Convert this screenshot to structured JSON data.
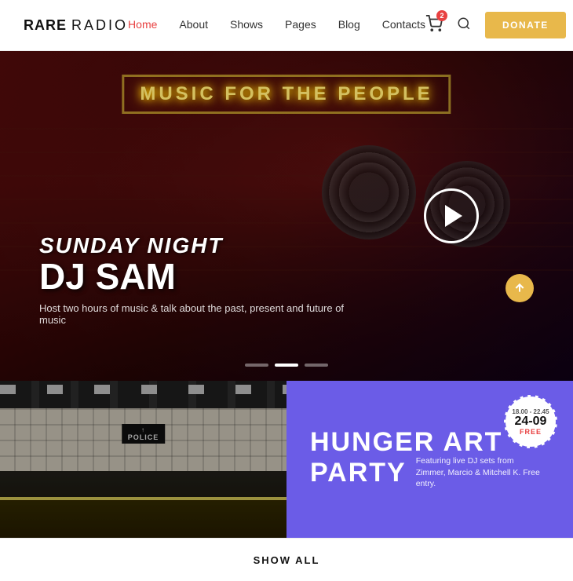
{
  "navbar": {
    "logo": {
      "part1": "RARE",
      "part2": "RADIO"
    },
    "links": [
      {
        "id": "home",
        "label": "Home",
        "active": true
      },
      {
        "id": "about",
        "label": "About",
        "active": false
      },
      {
        "id": "shows",
        "label": "Shows",
        "active": false
      },
      {
        "id": "pages",
        "label": "Pages",
        "active": false
      },
      {
        "id": "blog",
        "label": "Blog",
        "active": false
      },
      {
        "id": "contacts",
        "label": "Contacts",
        "active": false
      }
    ],
    "cart_badge": "2",
    "donate_label": "DONATE"
  },
  "hero": {
    "neon_text": "MUSIC FOR THE PEOPLE",
    "subtitle": "Sunday Night",
    "title": "DJ SAM",
    "description": "Host two hours of music & talk about the past, present and future of music"
  },
  "event": {
    "title_line1": "HUNGER ART",
    "title_line2": "PARTY",
    "description": "Featuring live DJ sets from Zimmer, Marcio & Mitchell K. Free entry.",
    "badge_time": "18.00 - 22.45",
    "badge_date": "24-09",
    "badge_free": "FREE"
  },
  "footer": {
    "show_all_label": "SHOW ALL"
  }
}
